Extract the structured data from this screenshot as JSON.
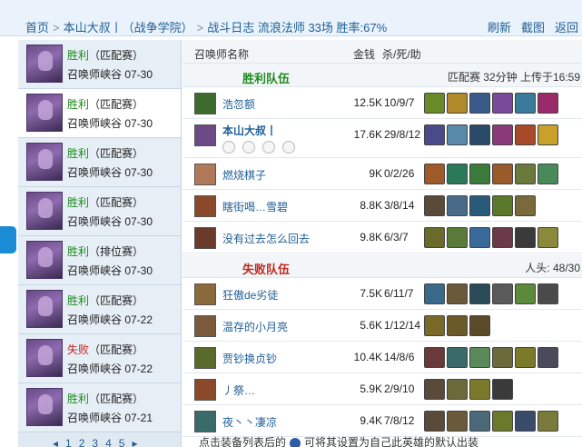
{
  "breadcrumb": {
    "home": "首页",
    "player": "本山大叔丨（战争学院）",
    "log": "战斗日志 流浪法师 33场 胜率:67%"
  },
  "actions": {
    "refresh": "刷新",
    "screenshot": "截图",
    "back": "返回"
  },
  "matches": [
    {
      "result": "胜利",
      "result_kind": "win",
      "type": "（匹配赛）",
      "map": "召唤师峡谷 07-30"
    },
    {
      "result": "胜利",
      "result_kind": "win",
      "type": "（匹配赛）",
      "map": "召唤师峡谷 07-30"
    },
    {
      "result": "胜利",
      "result_kind": "win",
      "type": "（匹配赛）",
      "map": "召唤师峡谷 07-30"
    },
    {
      "result": "胜利",
      "result_kind": "win",
      "type": "（匹配赛）",
      "map": "召唤师峡谷 07-30"
    },
    {
      "result": "胜利",
      "result_kind": "win",
      "type": "（排位赛）",
      "map": "召唤师峡谷 07-30"
    },
    {
      "result": "胜利",
      "result_kind": "win",
      "type": "（匹配赛）",
      "map": "召唤师峡谷 07-22"
    },
    {
      "result": "失败",
      "result_kind": "loss",
      "type": "（匹配赛）",
      "map": "召唤师峡谷 07-22"
    },
    {
      "result": "胜利",
      "result_kind": "win",
      "type": "（匹配赛）",
      "map": "召唤师峡谷 07-21"
    }
  ],
  "pager": [
    "1",
    "2",
    "3",
    "4",
    "5"
  ],
  "columns": {
    "name": "召唤师名称",
    "gold": "金钱",
    "kda": "杀/死/助"
  },
  "win_team": {
    "label": "胜利队伍",
    "info": "匹配赛 32分钟 上传于16:59",
    "color": "#1f8a1f"
  },
  "loss_team": {
    "label": "失败队伍",
    "info": "人头: 48/30",
    "color": "#c0271f"
  },
  "win_players": [
    {
      "name": "浩忽额",
      "gold": "12.5K",
      "kda": "10/9/7",
      "champ_color": "#3d6b2e",
      "items": [
        "#6a8a2a",
        "#b08a2a",
        "#3a5a8a",
        "#7a4a9a",
        "#3a7a9a",
        "#9a2a6a"
      ]
    },
    {
      "name": "本山大叔丨",
      "gold": "17.6K",
      "kda": "29/8/12",
      "champ_color": "#6b4a86",
      "items": [
        "#4a4a8a",
        "#5a8aaa",
        "#2a4a6a",
        "#8a3a7a",
        "#a84a2a",
        "#c8a02a"
      ]
    },
    {
      "name": "燃烧棋子",
      "gold": "9K",
      "kda": "0/2/26",
      "champ_color": "#b07a5a",
      "items": [
        "#a05a2a",
        "#2a7a5a",
        "#3a7a3a",
        "#9a5a2a",
        "#6a7a3a",
        "#4a8a5a"
      ]
    },
    {
      "name": "瞎街喝…雪碧",
      "gold": "8.8K",
      "kda": "3/8/14",
      "champ_color": "#8a4a2a",
      "items": [
        "#5a4a3a",
        "#4a6a8a",
        "#2a5a7a",
        "#5a7a2a",
        "#7a6a3a"
      ]
    },
    {
      "name": "没有过去怎么回去",
      "gold": "9.8K",
      "kda": "6/3/7",
      "champ_color": "#6a3a2a",
      "items": [
        "#6a6a2a",
        "#5a7a3a",
        "#3a6a9a",
        "#6a3a4a",
        "#3a3a3a",
        "#8a8a3a"
      ]
    }
  ],
  "loss_players": [
    {
      "name": "狂傲de劣徒",
      "gold": "7.5K",
      "kda": "6/11/7",
      "champ_color": "#8a6a3a",
      "items": [
        "#3a6a8a",
        "#6a5a3a",
        "#2a4a5a",
        "#5a5a5a",
        "#5a8a3a",
        "#4a4a4a"
      ]
    },
    {
      "name": "温存的小月亮",
      "gold": "5.6K",
      "kda": "1/12/14",
      "champ_color": "#7a5a3a",
      "items": [
        "#7a6a2a",
        "#6a5a2a",
        "#5a4a2a"
      ]
    },
    {
      "name": "贾钞换贞钞",
      "gold": "10.4K",
      "kda": "14/8/6",
      "champ_color": "#5a6a2a",
      "items": [
        "#6a3a3a",
        "#3a6a6a",
        "#5a8a5a",
        "#6a6a3a",
        "#7a7a2a",
        "#4a4a5a"
      ]
    },
    {
      "name": "丿祭…",
      "gold": "5.9K",
      "kda": "2/9/10",
      "champ_color": "#8a4a2a",
      "items": [
        "#5a4a3a",
        "#6a6a3a",
        "#7a7a2a",
        "#3a3a3a"
      ]
    },
    {
      "name": "夜丶丶凄凉",
      "gold": "9.4K",
      "kda": "7/8/12",
      "champ_color": "#3a6a6a",
      "items": [
        "#5a4a3a",
        "#6a5a3a",
        "#4a6a7a",
        "#6a7a2a",
        "#3a4a6a",
        "#7a7a3a"
      ]
    }
  ],
  "footer": {
    "text_a": "点击装备列表后的",
    "text_b": "可将其设置为自己此英雄的默认出装"
  }
}
